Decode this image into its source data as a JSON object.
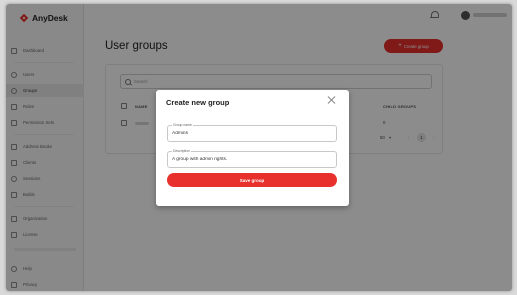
{
  "app": {
    "brand": "AnyDesk",
    "accent_color": "#e8302c"
  },
  "sidebar": {
    "items": [
      {
        "label": "Dashboard",
        "icon": "dashboard-icon"
      },
      {
        "label": "Users",
        "icon": "user-icon"
      },
      {
        "label": "Groups",
        "icon": "groups-icon",
        "active": true
      },
      {
        "label": "Roles",
        "icon": "roles-icon"
      },
      {
        "label": "Permission Sets",
        "icon": "permission-icon"
      },
      {
        "label": "Address Books",
        "icon": "address-book-icon"
      },
      {
        "label": "Clients",
        "icon": "clients-icon"
      },
      {
        "label": "Sessions",
        "icon": "sessions-icon"
      },
      {
        "label": "Builds",
        "icon": "builds-icon"
      },
      {
        "label": "Organization",
        "icon": "organization-icon"
      },
      {
        "label": "License",
        "icon": "license-icon"
      },
      {
        "label": "Help",
        "icon": "help-icon"
      },
      {
        "label": "Privacy",
        "icon": "privacy-icon"
      }
    ]
  },
  "topbar": {
    "bell_icon": "bell-icon",
    "avatar_icon": "avatar-icon"
  },
  "main": {
    "title": "User groups",
    "create_button": "Create group",
    "search_placeholder": "Search",
    "columns": {
      "name": "NAME",
      "child_groups": "CHILD GROUPS"
    },
    "row": {
      "child_groups": "0"
    },
    "pagination": {
      "page_size": "50",
      "current_page": "1"
    }
  },
  "modal": {
    "title": "Create new group",
    "fields": {
      "group_name_label": "Group name",
      "group_name_value": "Admins",
      "description_label": "Description",
      "description_value": "A group with admin rights."
    },
    "submit_label": "Save group"
  }
}
